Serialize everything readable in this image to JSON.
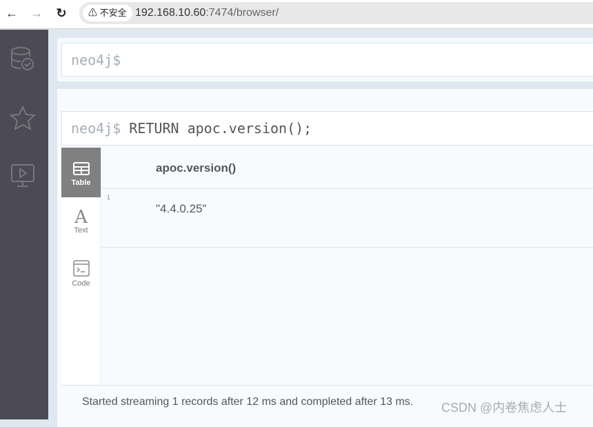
{
  "browser": {
    "back_icon": "arrow-left",
    "forward_icon": "arrow-right",
    "reload_icon": "reload",
    "security_label": "不安全",
    "url_host": "192.168.10.60",
    "url_path": ":7474/browser/"
  },
  "sidebar": {
    "items": [
      {
        "icon": "database-check"
      },
      {
        "icon": "star"
      },
      {
        "icon": "monitor-play"
      }
    ]
  },
  "editor": {
    "prompt": "neo4j$"
  },
  "result": {
    "prompt": "neo4j$",
    "query": "RETURN apoc.version();",
    "tabs": [
      {
        "label": "Table",
        "active": true
      },
      {
        "label": "Text"
      },
      {
        "label": "Code"
      }
    ],
    "columns": [
      "apoc.version()"
    ],
    "rows": [
      {
        "index": "1",
        "values": [
          "\"4.4.0.25\""
        ]
      }
    ],
    "status": "Started streaming 1 records after 12 ms and completed after 13 ms."
  },
  "watermark": "CSDN @内卷焦虑人士"
}
